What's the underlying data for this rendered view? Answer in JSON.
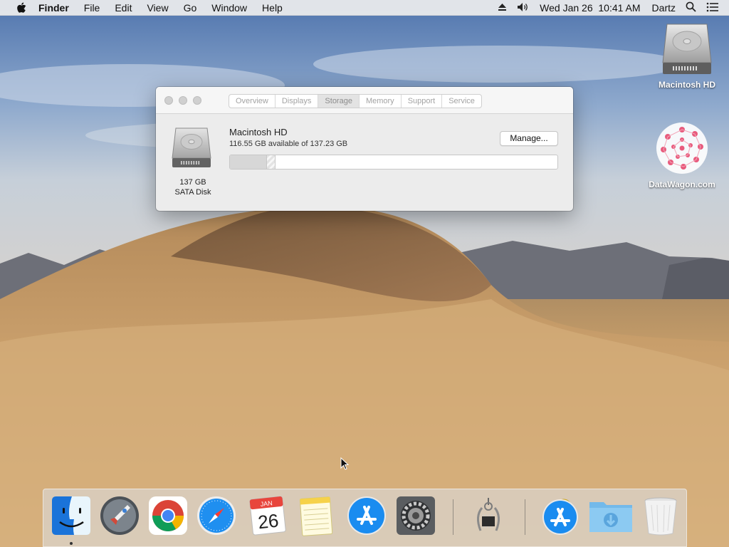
{
  "menubar": {
    "app_name": "Finder",
    "items": [
      "File",
      "Edit",
      "View",
      "Go",
      "Window",
      "Help"
    ],
    "clock": "Wed Jan 26  10:41 AM",
    "user": "Dartz"
  },
  "desktop": {
    "icons": [
      {
        "label": "Macintosh HD",
        "icon": "hard-drive-icon"
      },
      {
        "label": "DataWagon.com",
        "icon": "datawagon-logo-icon"
      }
    ]
  },
  "about_window": {
    "tabs": [
      "Overview",
      "Displays",
      "Storage",
      "Memory",
      "Support",
      "Service"
    ],
    "active_tab": "Storage",
    "disk": {
      "size": "137 GB",
      "type": "SATA Disk",
      "volume_name": "Macintosh HD",
      "available": "116.55 GB available of 137.23 GB"
    },
    "manage_label": "Manage...",
    "usage": {
      "used_fraction": 0.11,
      "other_fraction": 0.03
    }
  },
  "dock": {
    "apps": [
      "finder-icon",
      "launchpad-icon",
      "chrome-icon",
      "safari-icon",
      "calendar-icon",
      "notes-icon",
      "app-store-icon",
      "system-preferences-icon",
      "system-information-icon",
      "app-store-downloads-icon",
      "downloads-folder-icon",
      "trash-icon"
    ],
    "calendar": {
      "month": "JAN",
      "day": "26"
    }
  },
  "colors": {
    "accent_blue": "#1a8cf0",
    "window_bg": "#ececec"
  }
}
